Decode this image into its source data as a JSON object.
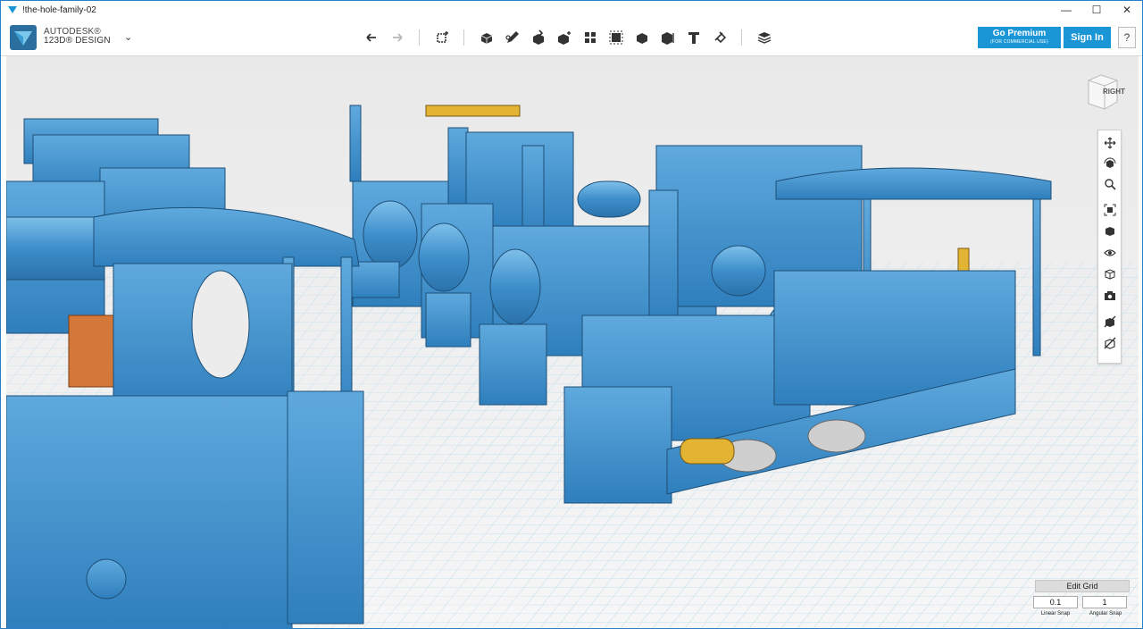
{
  "window": {
    "title": "!the-hole-family-02",
    "controls": [
      "—",
      "☐",
      "✕"
    ]
  },
  "brand": {
    "line1": "AUTODESK®",
    "line2": "123D® DESIGN",
    "menu_caret": "⌄"
  },
  "toolbar": {
    "tools": [
      {
        "icon": "undo-icon"
      },
      {
        "icon": "redo-icon",
        "dim": true
      },
      {
        "icon": "transform-icon"
      },
      {
        "icon": "primitives-icon"
      },
      {
        "icon": "sketch-icon"
      },
      {
        "icon": "construct-icon"
      },
      {
        "icon": "modify-icon"
      },
      {
        "icon": "pattern-icon"
      },
      {
        "icon": "group-icon"
      },
      {
        "icon": "combine-icon"
      },
      {
        "icon": "measure-icon"
      },
      {
        "icon": "text-icon"
      },
      {
        "icon": "snap-icon"
      },
      {
        "icon": "material-icon"
      }
    ]
  },
  "premium": {
    "label": "Go Premium",
    "sub": "(FOR COMMERCIAL USE)"
  },
  "signin": {
    "label": "Sign In"
  },
  "help": {
    "label": "?"
  },
  "viewcube": {
    "face": "RIGHT"
  },
  "navbar": {
    "buttons": [
      "pan-icon",
      "orbit-icon",
      "zoom-icon",
      "fit-icon",
      "view-icon",
      "visibility-icon",
      "materials-icon",
      "camera-icon",
      "hide-icon",
      "outline-icon"
    ]
  },
  "grid": {
    "edit_label": "Edit Grid",
    "linear_snap_value": "0.1",
    "angular_snap_value": "1",
    "linear_snap_label": "Linear Snap",
    "angular_snap_label": "Angular Snap"
  },
  "colors": {
    "accent": "#1a96d6",
    "model": "#3f8fc9",
    "brass": "#e3b333",
    "copper": "#d47a3c"
  }
}
